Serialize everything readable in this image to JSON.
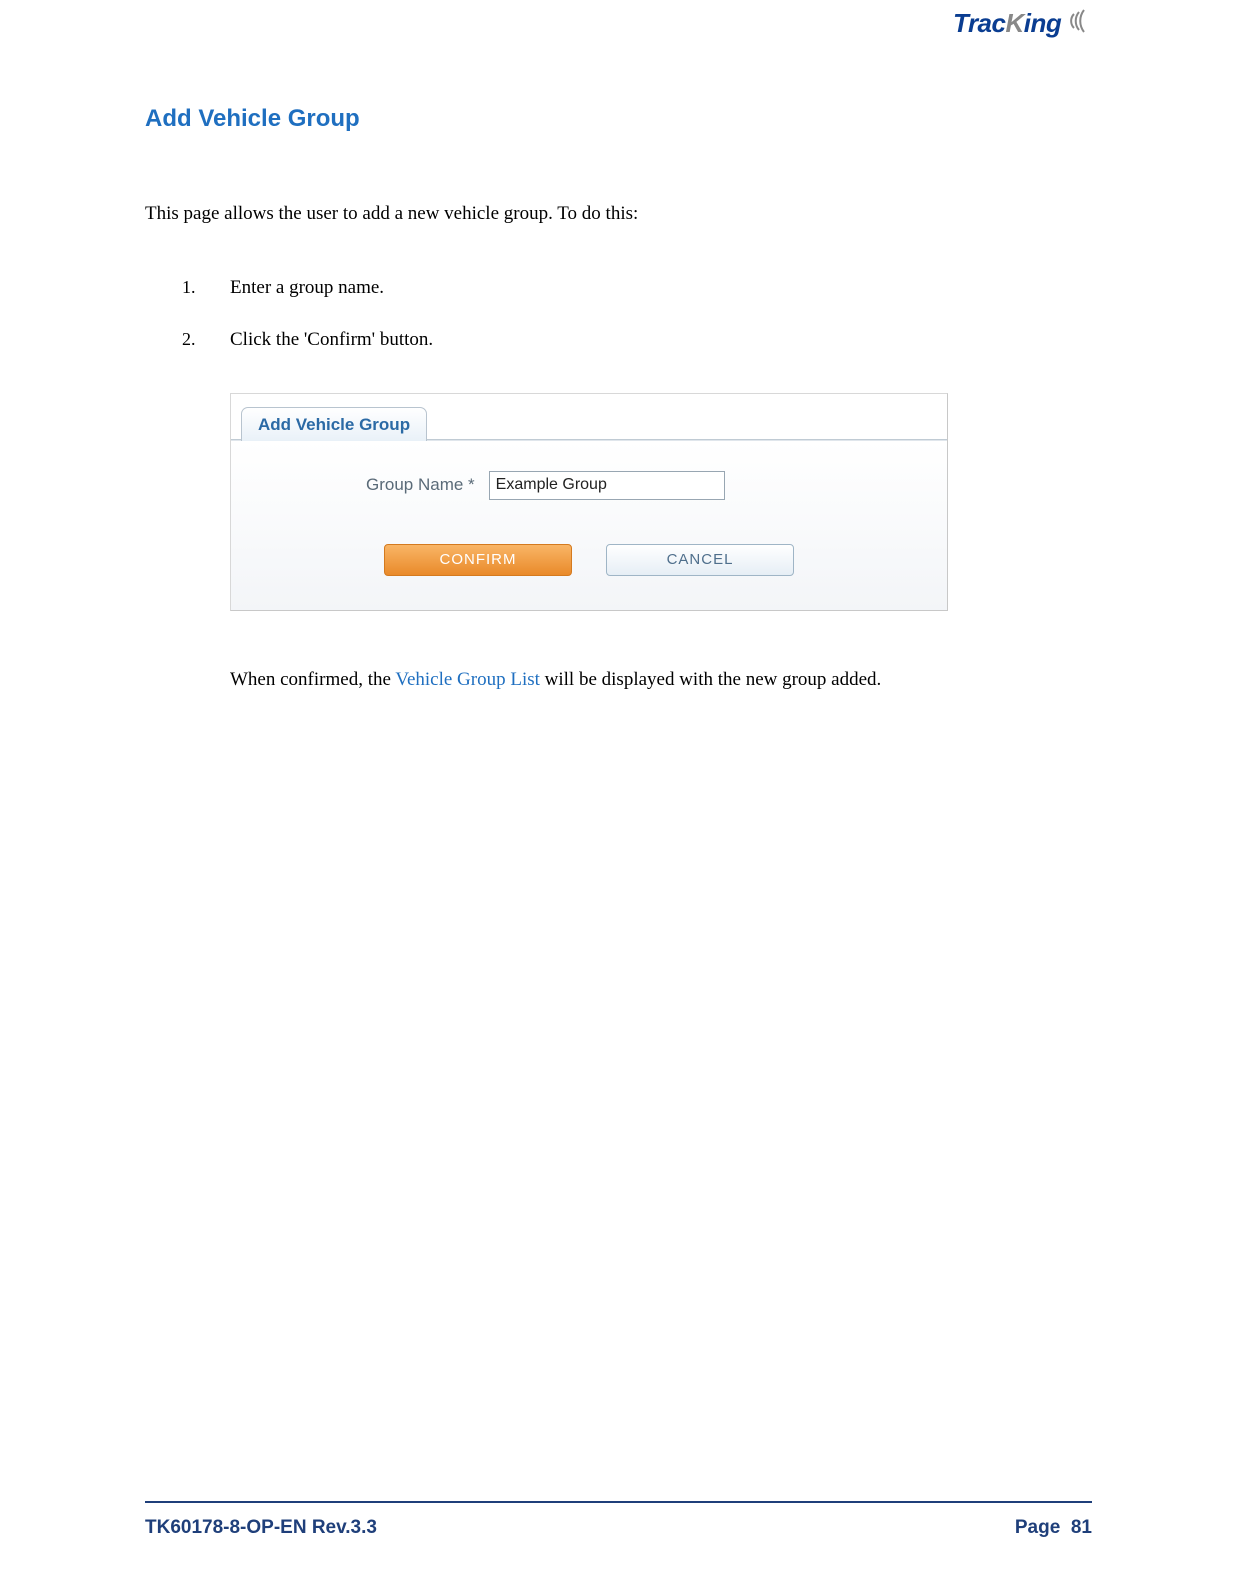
{
  "brand": {
    "part1": "Trac",
    "part2": "K",
    "part3": "ing"
  },
  "title": "Add Vehicle Group",
  "intro": "This page allows the user to add a new vehicle group. To do this:",
  "steps": [
    "Enter a group name.",
    "Click the 'Confirm' button."
  ],
  "embedded": {
    "tab_label": "Add Vehicle Group",
    "field_label": "Group Name *",
    "field_value": "Example Group",
    "confirm_btn": "CONFIRM",
    "cancel_btn": "CANCEL"
  },
  "note": {
    "prefix": "When confirmed, the ",
    "link": "Vehicle Group List",
    "suffix": " will be displayed with the new group added."
  },
  "footer": {
    "doc_id": "TK60178-8-OP-EN Rev.3.3",
    "page_label": "Page",
    "page_num": "81"
  }
}
